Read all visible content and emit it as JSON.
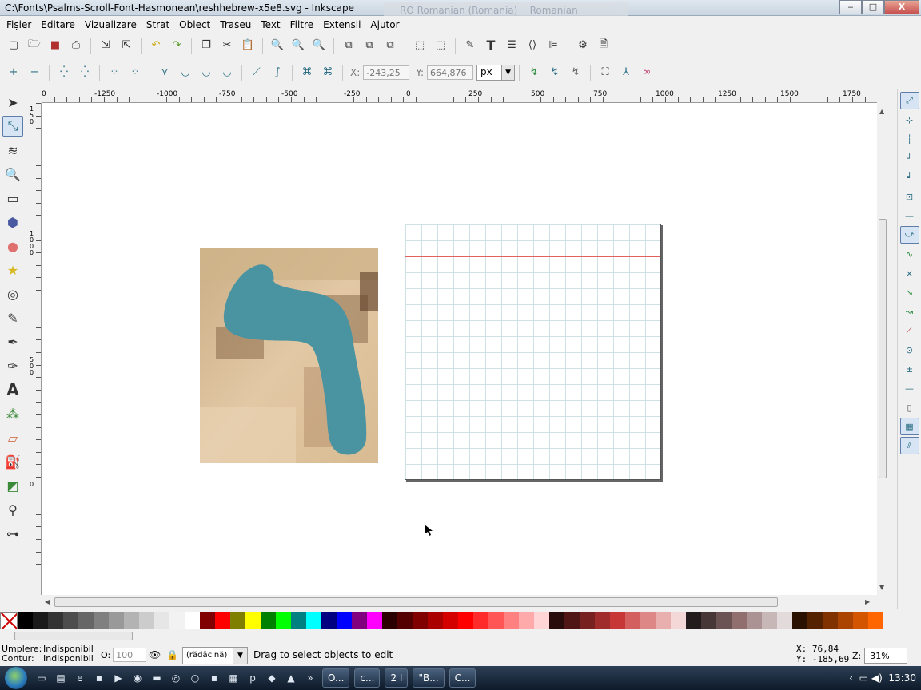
{
  "window": {
    "title": "C:\\Fonts\\Psalms-Scroll-Font-Hasmonean\\reshhebrew-x5e8.svg - Inkscape",
    "lang_primary": "RO Romanian (Romania)",
    "lang_secondary": "Romanian (Legacy)",
    "min_label": "‒",
    "max_label": "□",
    "close_label": "X"
  },
  "menu": [
    "Fișier",
    "Editare",
    "Vizualizare",
    "Strat",
    "Obiect",
    "Traseu",
    "Text",
    "Filtre",
    "Extensii",
    "Ajutor"
  ],
  "toolbar1_icons": [
    "new-doc-icon",
    "open-icon",
    "save-icon",
    "print-icon",
    "import-icon",
    "export-icon",
    "undo-icon",
    "redo-icon",
    "duplicate-icon",
    "cut-icon",
    "paste-icon",
    "zoom-selection-icon",
    "zoom-drawing-icon",
    "zoom-page-icon",
    "group-icon",
    "clone-icon",
    "unlink-icon",
    "ungroup-icon",
    "align-icon",
    "fill-stroke-icon",
    "text-tool-icon",
    "layers-icon",
    "xml-editor-icon",
    "align-distribute-icon",
    "preferences-icon",
    "document-props-icon"
  ],
  "nodebar": {
    "x_label": "X:",
    "x_value": "-243,25",
    "y_label": "Y:",
    "y_value": "664,876",
    "unit": "px"
  },
  "hruler_labels": [
    "0",
    "-1250",
    "-1000",
    "-750",
    "-500",
    "-250",
    "0",
    "250",
    "500",
    "750",
    "1000",
    "1250",
    "1500",
    "1750"
  ],
  "vruler_labels": [
    "150",
    "1000",
    "500",
    "0"
  ],
  "tools": [
    "selector",
    "node",
    "tweak",
    "zoom",
    "rectangle",
    "3dbox",
    "ellipse",
    "star",
    "spiral",
    "pencil",
    "pen",
    "calligraphy",
    "text",
    "spray",
    "eraser",
    "bucket",
    "gradient",
    "dropper",
    "connector"
  ],
  "snap": [
    "snap-toggle",
    "snap-bbox",
    "snap-bbox-edge",
    "snap-bbox-corner",
    "snap-bbox-midpoint",
    "snap-bbox-center",
    "snap-nodes",
    "snap-paths",
    "snap-intersections",
    "snap-cusp",
    "snap-smooth",
    "snap-midpoint",
    "snap-object-center",
    "snap-rotation-center",
    "snap-page-border",
    "snap-grid",
    "snap-guide"
  ],
  "palette": {
    "colors": [
      "#000000",
      "#1a1a1a",
      "#333333",
      "#4d4d4d",
      "#666666",
      "#808080",
      "#999999",
      "#b3b3b3",
      "#cccccc",
      "#e6e6e6",
      "#f2f2f2",
      "#ffffff",
      "#800000",
      "#ff0000",
      "#808000",
      "#ffff00",
      "#008000",
      "#00ff00",
      "#008080",
      "#00ffff",
      "#000080",
      "#0000ff",
      "#800080",
      "#ff00ff",
      "#2b0000",
      "#550000",
      "#800000",
      "#aa0000",
      "#d40000",
      "#ff0000",
      "#ff2a2a",
      "#ff5555",
      "#ff8080",
      "#ffaaaa",
      "#ffd5d5",
      "#280b0b",
      "#501616",
      "#782121",
      "#a02c2c",
      "#c83737",
      "#d35f5f",
      "#de8787",
      "#e9afaf",
      "#f4d7d7",
      "#241c1c",
      "#483737",
      "#6c5353",
      "#916f6f",
      "#ac9393",
      "#c8b7b7",
      "#e3dbdb",
      "#2b1100",
      "#552200",
      "#803300",
      "#aa4400",
      "#d45500",
      "#ff6600"
    ]
  },
  "status": {
    "fill_label": "Umplere:",
    "fill_value": "Indisponibil",
    "stroke_label": "Contur:",
    "stroke_value": "Indisponibil",
    "opacity_label": "O:",
    "opacity_value": "100",
    "layer": "(rădăcină)",
    "message": "Drag to select objects to edit",
    "cursor_x": "X:   76,84",
    "cursor_y": "Y: -185,69",
    "zoom_label": "Z:",
    "zoom_value": "31%"
  },
  "taskbar": {
    "tasks": [
      "O...",
      "c...",
      "2 I",
      "\"B...",
      "C..."
    ],
    "clock": "13:30"
  },
  "colors": {
    "glyph_fill": "#4a94a2",
    "guide": "#e06060",
    "grid": "#cfe0e6"
  }
}
